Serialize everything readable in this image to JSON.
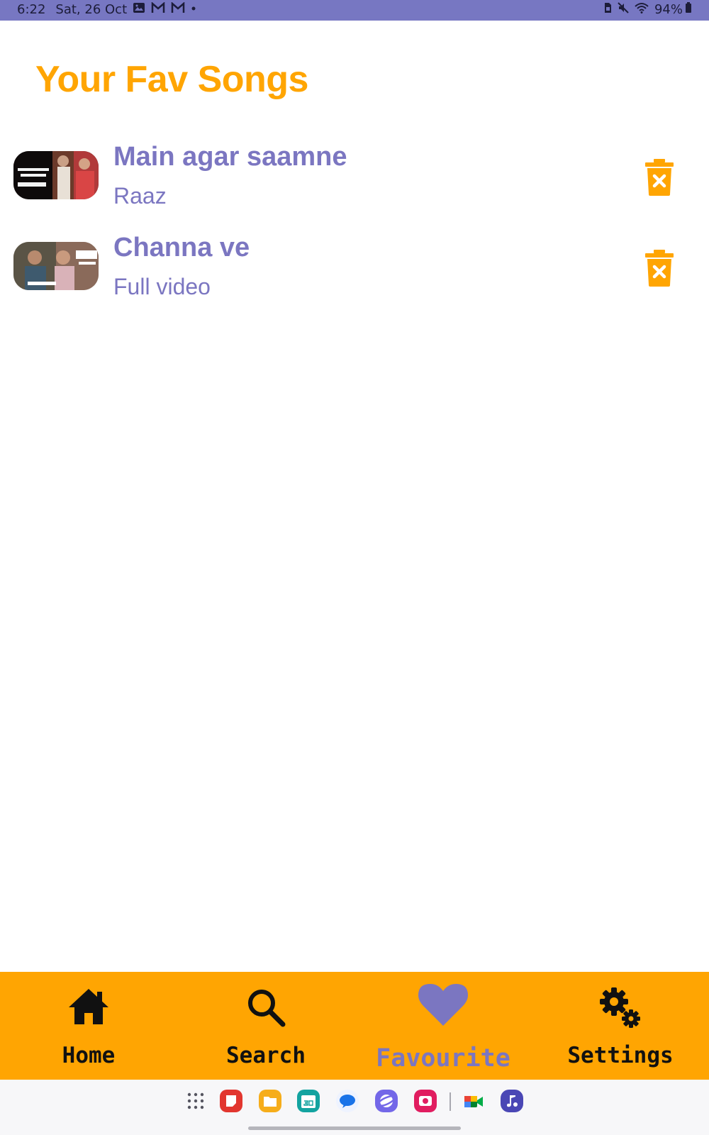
{
  "status_bar": {
    "time": "6:22",
    "date": "Sat, 26 Oct",
    "battery": "94%"
  },
  "header": {
    "title": "Your Fav Songs"
  },
  "songs": [
    {
      "title": "Main agar saamne",
      "subtitle": "Raaz"
    },
    {
      "title": "Channa ve",
      "subtitle": "Full video"
    }
  ],
  "nav": {
    "items": [
      {
        "label": "Home",
        "icon": "home-icon"
      },
      {
        "label": "Search",
        "icon": "search-icon"
      },
      {
        "label": "Favourite",
        "icon": "heart-icon"
      },
      {
        "label": "Settings",
        "icon": "gears-icon"
      }
    ],
    "active": "Favourite"
  },
  "colors": {
    "accent": "#ffa502",
    "primary": "#7b76c1",
    "status_bar": "#7777c2"
  }
}
